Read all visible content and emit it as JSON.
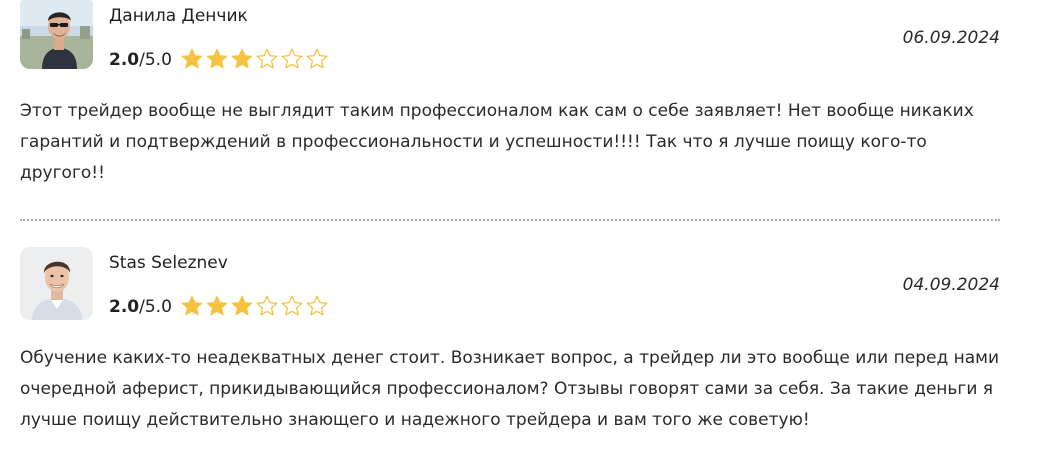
{
  "colors": {
    "star_filled": "#F5C242",
    "star_outline": "#F5C242",
    "divider": "#A8A8A8",
    "text": "#2A2A2A"
  },
  "icons": {
    "filled_star": "star-filled-icon",
    "empty_star": "star-outline-icon"
  },
  "reviews": [
    {
      "author": "Данила Денчик",
      "rating_value": "2.0",
      "rating_max": "/5.0",
      "stars_filled": 3,
      "stars_total": 6,
      "date": "06.09.2024",
      "text": "Этот трейдер вообще не выглядит таким профессионалом как сам о себе заявляет! Нет вообще никаких гарантий и подтверждений в профессиональности и успешности!!!! Так что я лучше поищу кого-то другого!!",
      "avatar": "avatar-photo-man-sunglasses"
    },
    {
      "author": "Stas Seleznev",
      "rating_value": "2.0",
      "rating_max": "/5.0",
      "stars_filled": 3,
      "stars_total": 6,
      "date": "04.09.2024",
      "text": "Обучение каких-то неадекватных денег стоит. Возникает вопрос, а трейдер ли это вообще или перед нами очередной аферист, прикидывающийся профессионалом? Отзывы говорят сами за себя. За такие деньги я лучше поищу действительно знающего и надежного трейдера и вам того же советую!",
      "avatar": "avatar-photo-man-smiling"
    }
  ]
}
